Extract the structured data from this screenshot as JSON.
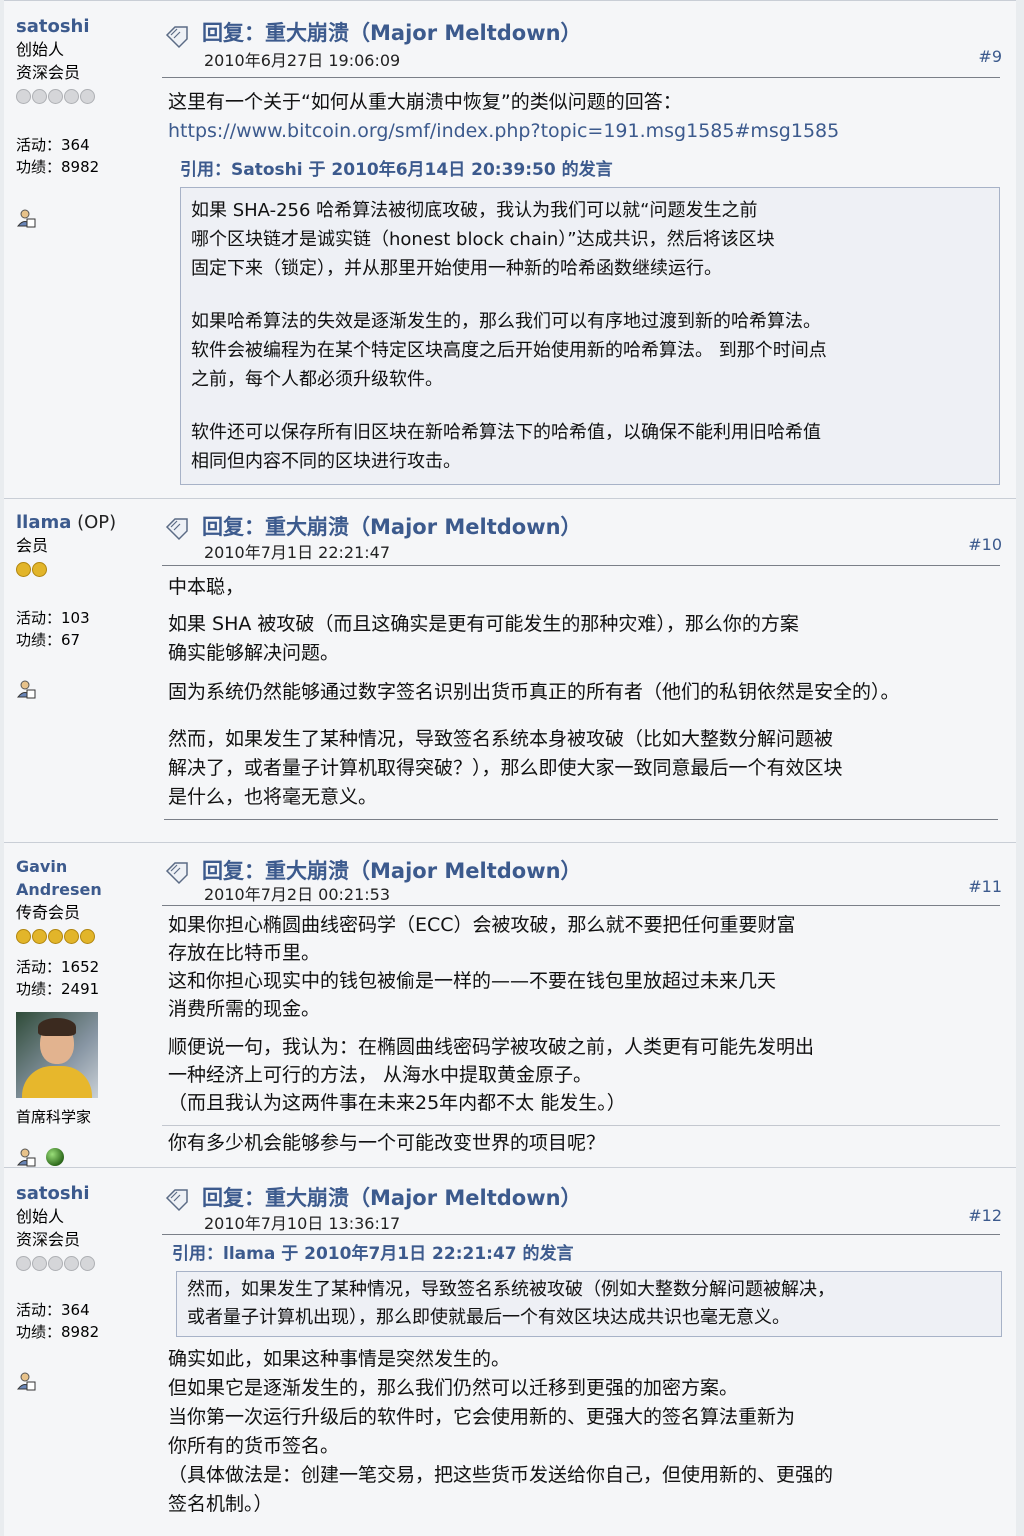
{
  "posts": [
    {
      "name": "satoshi",
      "name_suffix": "",
      "role": "创始人",
      "rank": "资深会员",
      "stars": 5,
      "stars_gold": 0,
      "activity": "活动：364",
      "merit": "功绩：8982",
      "subject": "回复：重大崩溃（Major Meltdown）",
      "date": "2010年6月27日 19:06:09",
      "num": "#9",
      "body_line1": "这里有一个关于“如何从重大崩溃中恢复”的类似问题的回答：",
      "link": "https://www.bitcoin.org/smf/index.php?topic=191.msg1585#msg1585",
      "quote_head": "引用：Satoshi 于 2010年6月14日 20:39:50 的发言",
      "quote_p1_l1": "如果 SHA-256 哈希算法被彻底攻破，我认为我们可以就“问题发生之前",
      "quote_p1_l2": "哪个区块链才是诚实链（honest block chain）”达成共识，然后将该区块",
      "quote_p1_l3": "固定下来（锁定），并从那里开始使用一种新的哈希函数继续运行。",
      "quote_p2_l1": "如果哈希算法的失效是逐渐发生的，那么我们可以有序地过渡到新的哈希算法。",
      "quote_p2_l2": "软件会被编程为在某个特定区块高度之后开始使用新的哈希算法。 到那个时间点",
      "quote_p2_l3": "之前，每个人都必须升级软件。",
      "quote_p3_l1": "软件还可以保存所有旧区块在新哈希算法下的哈希值，以确保不能利用旧哈希值",
      "quote_p3_l2": "相同但内容不同的区块进行攻击。"
    },
    {
      "name": "llama",
      "name_suffix": " (OP)",
      "role": "会员",
      "stars": 2,
      "stars_gold": 2,
      "activity": "活动：103",
      "merit": "功绩：67",
      "subject": "回复：重大崩溃（Major Meltdown）",
      "date": "2010年7月1日 22:21:47",
      "num": "#10",
      "l1": "中本聪，",
      "l2": "如果 SHA 被攻破（而且这确实是更有可能发生的那种灾难），那么你的方案",
      "l3": "确实能够解决问题。",
      "l4": "固为系统仍然能够通过数字签名识别出货币真正的所有者（他们的私钥依然是安全的）。",
      "l5": "然而，如果发生了某种情况，导致签名系统本身被攻破（比如大整数分解问题被",
      "l6": "解决了，或者量子计算机取得突破？），那么即使大家一致同意最后一个有效区块",
      "l7": "是什么，也将毫无意义。"
    },
    {
      "name": "Gavin Andresen",
      "name_suffix": "",
      "role": "传奇会员",
      "stars": 5,
      "stars_gold": 5,
      "activity": "活动：1652",
      "merit": "功绩：2491",
      "title": "首席科学家",
      "subject": "回复：重大崩溃（Major Meltdown）",
      "date": "2010年7月2日 00:21:53",
      "num": "#11",
      "l1": "如果你担心椭圆曲线密码学（ECC）会被攻破，那么就不要把任何重要财富",
      "l2": "存放在比特币里。",
      "l3": "这和你担心现实中的钱包被偷是一样的——不要在钱包里放超过未来几天",
      "l4": "消费所需的现金。",
      "l5": "顺便说一句，我认为：在椭圆曲线密码学被攻破之前，人类更有可能先发明出",
      "l6": "一种经济上可行的方法， 从海水中提取黄金原子。",
      "l7": "（而且我认为这两件事在未来25年内都不太 能发生。）",
      "sig": "你有多少机会能够参与一个可能改变世界的项目呢？"
    },
    {
      "name": "satoshi",
      "name_suffix": "",
      "role": "创始人",
      "rank": "资深会员",
      "stars": 5,
      "stars_gold": 0,
      "activity": "活动：364",
      "merit": "功绩：8982",
      "subject": "回复：重大崩溃（Major Meltdown）",
      "date": "2010年7月10日 13:36:17",
      "num": "#12",
      "quote_head": "引用：llama 于 2010年7月1日 22:21:47 的发言",
      "quote_l1": "然而，如果发生了某种情况，导致签名系统被攻破（例如大整数分解问题被解决，",
      "quote_l2": "或者量子计算机出现），那么即使就最后一个有效区块达成共识也毫无意义。",
      "l1": "确实如此，如果这种事情是突然发生的。",
      "l2": "但如果它是逐渐发生的，那么我们仍然可以迁移到更强的加密方案。",
      "l3": "当你第一次运行升级后的软件时，它会使用新的、更强大的签名算法重新为",
      "l4": "你所有的货币签名。",
      "l5": "（具体做法是：创建一笔交易，把这些货币发送给你自己，但使用新的、更强的",
      "l6": "签名机制。）"
    }
  ]
}
